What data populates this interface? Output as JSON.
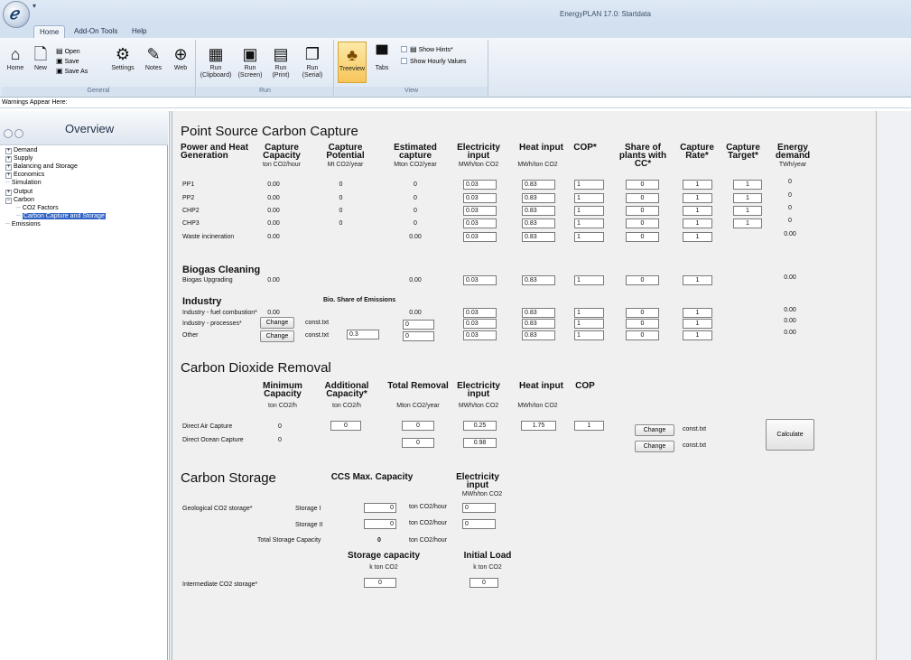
{
  "app_title": "EnergyPLAN 17.0: Startdata",
  "ribbon": {
    "tabs": [
      "Home",
      "Add-On Tools",
      "Help"
    ],
    "groups": {
      "general": "General",
      "run": "Run",
      "view": "View"
    },
    "buttons": {
      "home": "Home",
      "new": "New",
      "open": "Open",
      "save": "Save",
      "save_as": "Save As",
      "settings": "Settings",
      "notes": "Notes",
      "web": "Web",
      "run_clipboard": [
        "Run",
        "(Clipboard)"
      ],
      "run_screen": [
        "Run",
        "(Screen)"
      ],
      "run_print": [
        "Run",
        "(Print)"
      ],
      "run_serial": [
        "Run",
        "(Serial)"
      ],
      "treeview": "Treeview",
      "tabs": "Tabs",
      "show_hints": "Show Hints*",
      "show_hourly": "Show Hourly Values"
    }
  },
  "warnings_label": "Warnings Appear Here:",
  "overview": {
    "title": "Overview",
    "tree": [
      {
        "label": "Demand",
        "pm": "+"
      },
      {
        "label": "Supply",
        "pm": "+"
      },
      {
        "label": "Balancing and Storage",
        "pm": "+"
      },
      {
        "label": "Economics",
        "pm": "+"
      },
      {
        "label": "Simulation",
        "pm": ""
      },
      {
        "label": "Output",
        "pm": "+"
      },
      {
        "label": "Carbon",
        "pm": "−"
      },
      {
        "label": "CO2 Factors",
        "pm": ""
      },
      {
        "label": "Carbon Capture and Storage",
        "pm": ""
      },
      {
        "label": "Emissions",
        "pm": ""
      }
    ]
  },
  "pscc": {
    "title": "Point Source Carbon Capture",
    "headers": {
      "plant": "Power and Heat Generation",
      "cap_capacity": "Capture Capacity",
      "cap_potential": "Capture Potential",
      "est_capture": "Estimated capture",
      "elec_input": "Electricity input",
      "heat_input": "Heat input",
      "cop": "COP*",
      "share": "Share of plants with CC*",
      "rate": "Capture Rate*",
      "target": "Capture Target*",
      "energy": "Energy demand"
    },
    "units": {
      "cap_capacity": "ton CO2/hour",
      "cap_potential": "Mt CO2/year",
      "est_capture": "Mton CO2/year",
      "elec_input": "MWh/ton CO2",
      "heat_input": "MWh/ton CO2",
      "energy": "TWh/year"
    },
    "rows": [
      {
        "name": "PP1",
        "capacity": "0.00",
        "potential": "0",
        "estimated": "0",
        "elec": "0.03",
        "heat": "0.83",
        "cop": "1",
        "share": "0",
        "rate": "1",
        "target": "1",
        "energy": "0"
      },
      {
        "name": "PP2",
        "capacity": "0.00",
        "potential": "0",
        "estimated": "0",
        "elec": "0.03",
        "heat": "0.83",
        "cop": "1",
        "share": "0",
        "rate": "1",
        "target": "1",
        "energy": "0"
      },
      {
        "name": "CHP2",
        "capacity": "0.00",
        "potential": "0",
        "estimated": "0",
        "elec": "0.03",
        "heat": "0.83",
        "cop": "1",
        "share": "0",
        "rate": "1",
        "target": "1",
        "energy": "0"
      },
      {
        "name": "CHP3",
        "capacity": "0.00",
        "potential": "0",
        "estimated": "0",
        "elec": "0.03",
        "heat": "0.83",
        "cop": "1",
        "share": "0",
        "rate": "1",
        "target": "1",
        "energy": "0"
      },
      {
        "name": "Waste incineration",
        "capacity": "0.00",
        "estimated": "0.00",
        "elec": "0.03",
        "heat": "0.83",
        "cop": "1",
        "share": "0",
        "rate": "1",
        "energy": "0.00"
      }
    ],
    "biogas": {
      "title": "Biogas Cleaning",
      "row": {
        "name": "Biogas Upgrading",
        "capacity": "0.00",
        "estimated": "0.00",
        "elec": "0.03",
        "heat": "0.83",
        "cop": "1",
        "share": "0",
        "rate": "1",
        "energy": "0.00"
      }
    },
    "industry": {
      "title": "Industry",
      "bio_share_label": "Bio. Share of Emissions",
      "rows": [
        {
          "name": "Industry - fuel combustion*",
          "capacity": "0.00",
          "estimated": "0.00",
          "elec": "0.03",
          "heat": "0.83",
          "cop": "1",
          "share": "0",
          "rate": "1",
          "energy": "0.00"
        },
        {
          "name": "Industry - processes*",
          "change": "Change",
          "file": "const.txt",
          "estimated": "0",
          "elec": "0.03",
          "heat": "0.83",
          "cop": "1",
          "share": "0",
          "rate": "1",
          "energy": "0.00"
        },
        {
          "name": "Other",
          "change": "Change",
          "file": "const.txt",
          "bio": "0.3",
          "estimated": "0",
          "elec": "0.03",
          "heat": "0.83",
          "cop": "1",
          "share": "0",
          "rate": "1",
          "energy": "0.00"
        }
      ]
    }
  },
  "cdr": {
    "title": "Carbon Dioxide Removal",
    "headers": {
      "min_cap": "Minimum Capacity",
      "add_cap": "Additional Capacity*",
      "total": "Total Removal",
      "elec": "Electricity input",
      "heat": "Heat input",
      "cop": "COP"
    },
    "units": {
      "min_cap": "ton CO2/h",
      "add_cap": "ton CO2/h",
      "total": "Mton CO2/year",
      "elec": "MWh/ton CO2",
      "heat": "MWh/ton CO2"
    },
    "rows": [
      {
        "name": "Direct Air Capture",
        "min": "0",
        "add": "0",
        "total": "0",
        "elec": "0.25",
        "heat": "1.75",
        "cop": "1",
        "change": "Change",
        "file": "const.txt"
      },
      {
        "name": "Direct Ocean Capture",
        "min": "0",
        "total": "0",
        "elec": "0.98",
        "change": "Change",
        "file": "const.txt"
      }
    ],
    "calculate": "Calculate"
  },
  "storage": {
    "title": "Carbon Storage",
    "ccs_max": "CCS Max. Capacity",
    "elec_header": "Electricity input",
    "elec_unit": "MWh/ton CO2",
    "geo_label": "Geological CO2 storage*",
    "storage1_label": "Storage I",
    "storage1_value": "0",
    "storage1_unit": "ton CO2/hour",
    "storage1_elec": "0",
    "storage2_label": "Storage II",
    "storage2_value": "0",
    "storage2_unit": "ton CO2/hour",
    "storage2_elec": "0",
    "total_label": "Total Storage Capacity",
    "total_value": "0",
    "total_unit": "ton CO2/hour",
    "storage_capacity": "Storage capacity",
    "storage_capacity_unit": "k ton CO2",
    "initial_load": "Initial Load",
    "initial_load_unit": "k ton CO2",
    "intermediate_label": "Intermediate CO2 storage*",
    "intermediate_capacity": "0",
    "intermediate_initial": "0"
  }
}
